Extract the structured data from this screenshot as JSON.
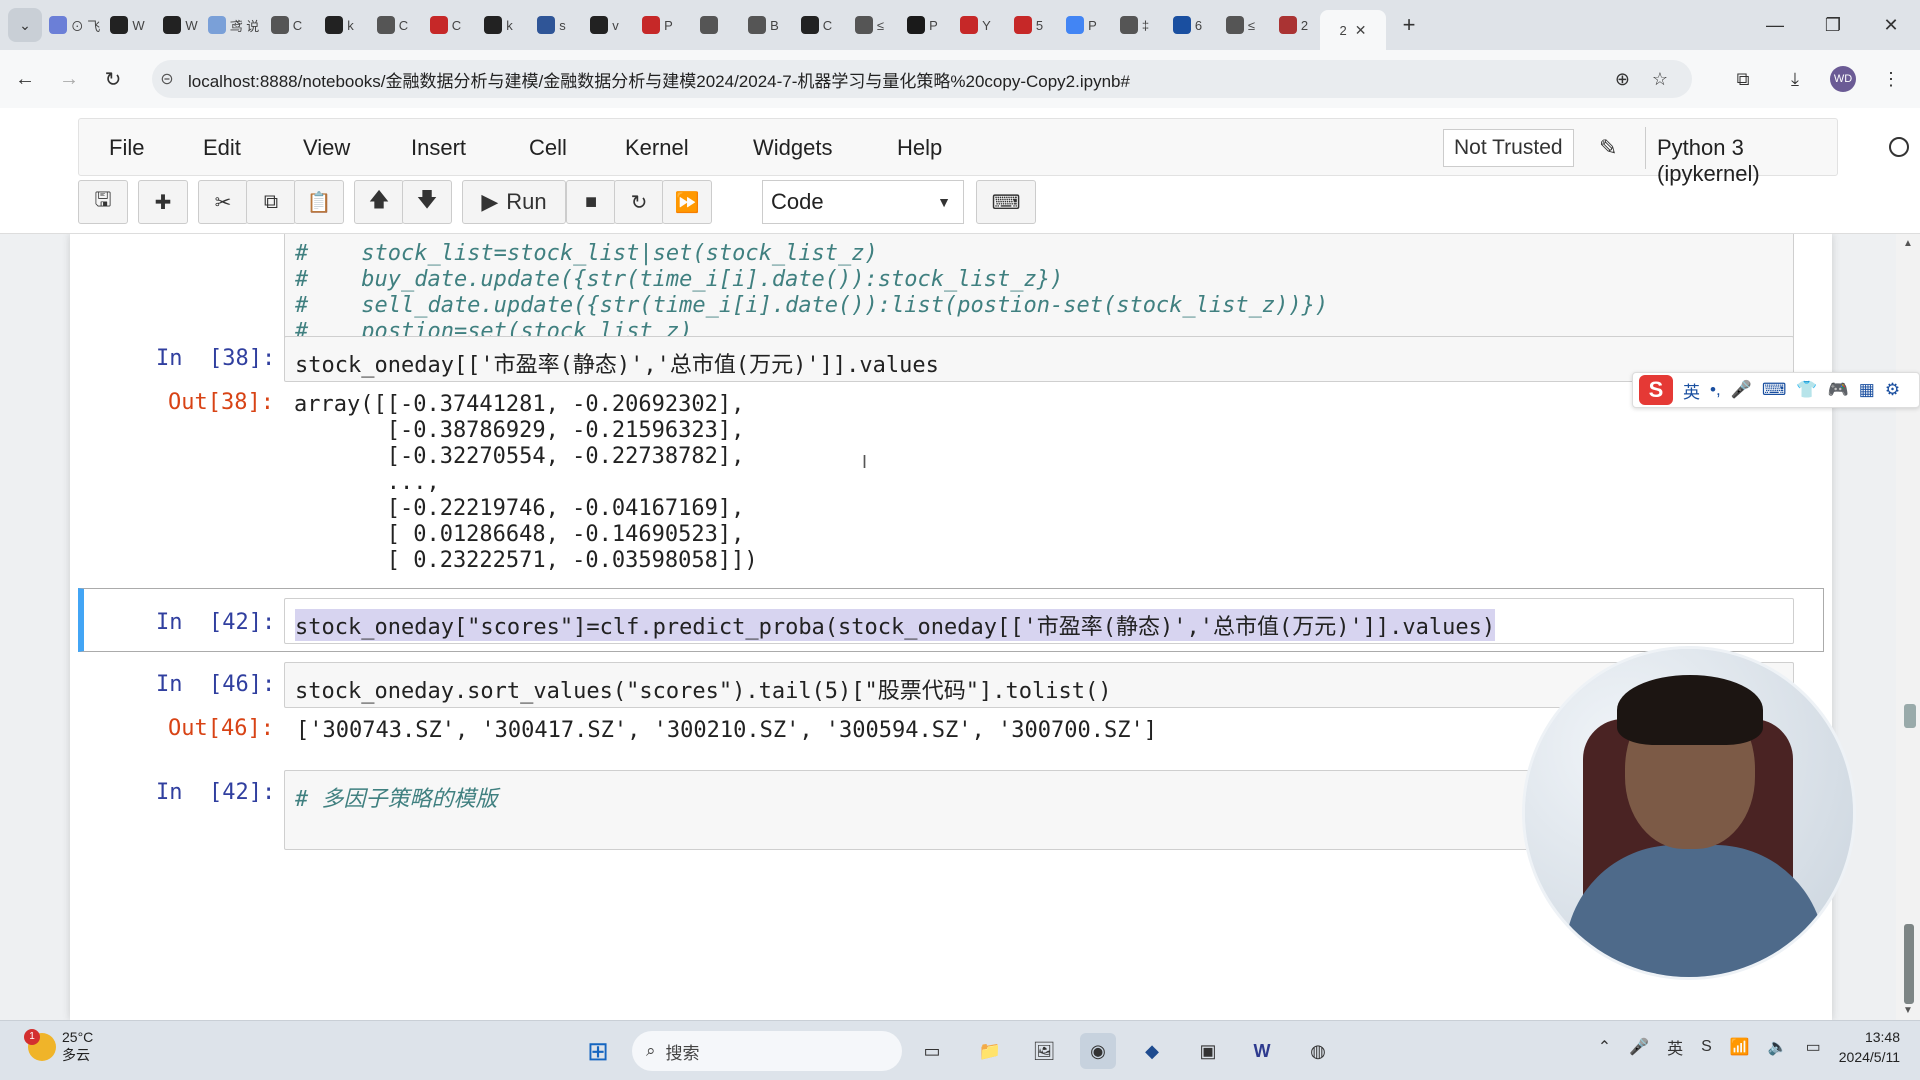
{
  "browser": {
    "tab_labels": [
      "⊙ 飞",
      "W",
      "W",
      "鸢 说",
      "C",
      "k",
      "C",
      "C",
      "k",
      "s",
      "v",
      "P",
      "",
      "B",
      "C",
      "≤",
      "P",
      "Y",
      "5",
      "P",
      "‡",
      "6",
      "≤",
      "2"
    ],
    "active_tab_number": "2",
    "new_tab": "+",
    "url": "localhost:8888/notebooks/金融数据分析与建模/金融数据分析与建模2024/2024-7-机器学习与量化策略%20copy-Copy2.ipynb#",
    "profile_initials": "WD"
  },
  "jupyter": {
    "menu": [
      "File",
      "Edit",
      "View",
      "Insert",
      "Cell",
      "Kernel",
      "Widgets",
      "Help"
    ],
    "not_trusted": "Not Trusted",
    "kernel_name": "Python 3 (ipykernel)",
    "run_label": "Run",
    "cell_type": "Code"
  },
  "cells": {
    "comment_block": [
      "#    stock_list=stock_list|set(stock_list_z)",
      "#    buy_date.update({str(time_i[i].date()):stock_list_z})",
      "#    sell_date.update({str(time_i[i].date()):list(postion-set(stock_list_z))})",
      "#    postion=set(stock_list_z)"
    ],
    "cell38": {
      "in_prompt": "In  [38]:",
      "code": "stock_oneday[['市盈率(静态)','总市值(万元)']].values",
      "out_prompt": "Out[38]:",
      "output": [
        "array([[-0.37441281, -0.20692302],",
        "       [-0.38786929, -0.21596323],",
        "       [-0.32270554, -0.22738782],",
        "       ...,",
        "       [-0.22219746, -0.04167169],",
        "       [ 0.01286648, -0.14690523],",
        "       [ 0.23222571, -0.03598058]])"
      ]
    },
    "cell42": {
      "in_prompt": "In  [42]:",
      "code": "stock_oneday[\"scores\"]=clf.predict_proba(stock_oneday[['市盈率(静态)','总市值(万元)']].values)"
    },
    "cell46": {
      "in_prompt": "In  [46]:",
      "code": "stock_oneday.sort_values(\"scores\").tail(5)[\"股票代码\"].tolist()",
      "out_prompt": "Out[46]:",
      "output": "['300743.SZ', '300417.SZ', '300210.SZ', '300594.SZ', '300700.SZ']"
    },
    "cell42b": {
      "in_prompt": "In  [42]:",
      "code": "# 多因子策略的模版"
    }
  },
  "ime": {
    "logo": "S",
    "mode": "英"
  },
  "taskbar": {
    "temperature": "25°C",
    "weather": "多云",
    "weather_badge": "1",
    "search_placeholder": "搜索",
    "time": "13:48",
    "date": "2024/5/11"
  },
  "colors": {
    "prompt_in": "#303f9f",
    "prompt_out": "#d84315",
    "selected_border": "#42a5f5",
    "comment": "#408080"
  }
}
